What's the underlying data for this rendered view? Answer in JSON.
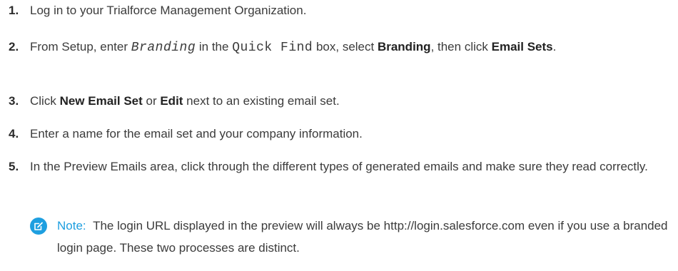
{
  "steps": [
    {
      "number": "1.",
      "text": "Log in to your Trialforce Management Organization."
    },
    {
      "number": "2.",
      "p1": "From Setup, enter ",
      "code1": "Branding",
      "p2": " in the ",
      "code2": "Quick Find",
      "p3": " box, select ",
      "b1": "Branding",
      "p4": ", then click ",
      "b2": "Email Sets",
      "p5": "."
    },
    {
      "number": "3.",
      "p1": "Click ",
      "b1": "New Email Set",
      "p2": " or ",
      "b2": "Edit",
      "p3": " next to an existing email set."
    },
    {
      "number": "4.",
      "text": "Enter a name for the email set and your company information."
    },
    {
      "number": "5.",
      "text": "In the Preview Emails area, click through the different types of generated emails and make sure they read correctly."
    }
  ],
  "note": {
    "label": "Note:",
    "text": "The login URL displayed in the preview will always be http://login.salesforce.com even if you use a branded login page. These two processes are distinct.",
    "icon": "edit-note-icon",
    "accent": "#1e9fe0"
  }
}
